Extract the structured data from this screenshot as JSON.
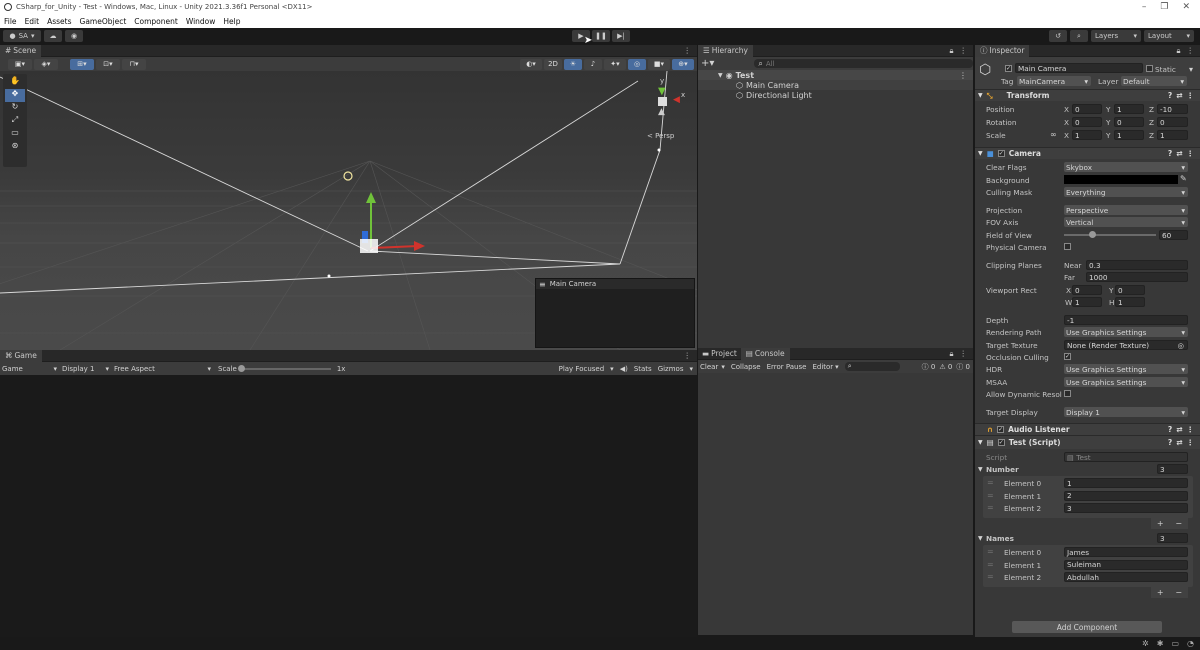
{
  "window": {
    "title": "CSharp_for_Unity - Test - Windows, Mac, Linux - Unity 2021.3.36f1 Personal <DX11>"
  },
  "menu": [
    "File",
    "Edit",
    "Assets",
    "GameObject",
    "Component",
    "Window",
    "Help"
  ],
  "toolbar": {
    "account": "SA",
    "layers": "Layers",
    "layout": "Layout"
  },
  "scene": {
    "tab": "Scene",
    "btn_2d": "2D",
    "persp": "< Persp",
    "cam_preview": "Main Camera",
    "gizmo_axes": {
      "y": "y",
      "x": "x",
      "z": "z"
    }
  },
  "game": {
    "tab": "Game",
    "mode": "Game",
    "display": "Display 1",
    "aspect": "Free Aspect",
    "scale_label": "Scale",
    "scale_value": "1x",
    "play_focused": "Play Focused",
    "stats": "Stats",
    "gizmos": "Gizmos"
  },
  "hierarchy": {
    "tab": "Hierarchy",
    "search_placeholder": "All",
    "scene": "Test",
    "items": [
      "Main Camera",
      "Directional Light"
    ]
  },
  "console": {
    "tab_project": "Project",
    "tab_console": "Console",
    "clear": "Clear",
    "collapse": "Collapse",
    "error_pause": "Error Pause",
    "editor": "Editor",
    "counts": [
      "0",
      "0",
      "0"
    ]
  },
  "inspector": {
    "tab": "Inspector",
    "object_name": "Main Camera",
    "static": "Static",
    "tag_label": "Tag",
    "tag": "MainCamera",
    "layer_label": "Layer",
    "layer": "Default",
    "transform": {
      "title": "Transform",
      "rows": [
        {
          "label": "Position",
          "x": "0",
          "y": "1",
          "z": "-10"
        },
        {
          "label": "Rotation",
          "x": "0",
          "y": "0",
          "z": "0"
        },
        {
          "label": "Scale",
          "x": "1",
          "y": "1",
          "z": "1"
        }
      ],
      "axis": {
        "x": "X",
        "y": "Y",
        "z": "Z"
      }
    },
    "camera": {
      "title": "Camera",
      "clear_flags_label": "Clear Flags",
      "clear_flags": "Skybox",
      "background_label": "Background",
      "culling_label": "Culling Mask",
      "culling": "Everything",
      "projection_label": "Projection",
      "projection": "Perspective",
      "fov_axis_label": "FOV Axis",
      "fov_axis": "Vertical",
      "fov_label": "Field of View",
      "fov": "60",
      "fov_fraction": 0.3,
      "physical_label": "Physical Camera",
      "clip_label": "Clipping Planes",
      "near_label": "Near",
      "near": "0.3",
      "far_label": "Far",
      "far": "1000",
      "viewport_label": "Viewport Rect",
      "vx": "0",
      "vy": "0",
      "vw": "1",
      "vh": "1",
      "vlabels": {
        "x": "X",
        "y": "Y",
        "w": "W",
        "h": "H"
      },
      "depth_label": "Depth",
      "depth": "-1",
      "render_path_label": "Rendering Path",
      "render_path": "Use Graphics Settings",
      "target_tex_label": "Target Texture",
      "target_tex": "None (Render Texture)",
      "occlusion_label": "Occlusion Culling",
      "occlusion_check": "✓",
      "hdr_label": "HDR",
      "hdr": "Use Graphics Settings",
      "msaa_label": "MSAA",
      "msaa": "Use Graphics Settings",
      "dyn_label": "Allow Dynamic Resolu",
      "target_display_label": "Target Display",
      "target_display": "Display 1"
    },
    "audio": {
      "title": "Audio Listener"
    },
    "script": {
      "title": "Test (Script)",
      "script_label": "Script",
      "script_value": "Test",
      "number_label": "Number",
      "number_size": "3",
      "numbers": [
        {
          "label": "Element 0",
          "value": "1"
        },
        {
          "label": "Element 1",
          "value": "2"
        },
        {
          "label": "Element 2",
          "value": "3"
        }
      ],
      "names_label": "Names",
      "names_size": "3",
      "names": [
        {
          "label": "Element 0",
          "value": "James"
        },
        {
          "label": "Element 1",
          "value": "Suleiman"
        },
        {
          "label": "Element 2",
          "value": "Abdullah"
        }
      ]
    },
    "add_component": "Add Component"
  },
  "colors": {
    "accent": "#486c9e",
    "x_axis": "#d0332c",
    "y_axis": "#70c23a",
    "z_axis": "#2f6bd6"
  }
}
